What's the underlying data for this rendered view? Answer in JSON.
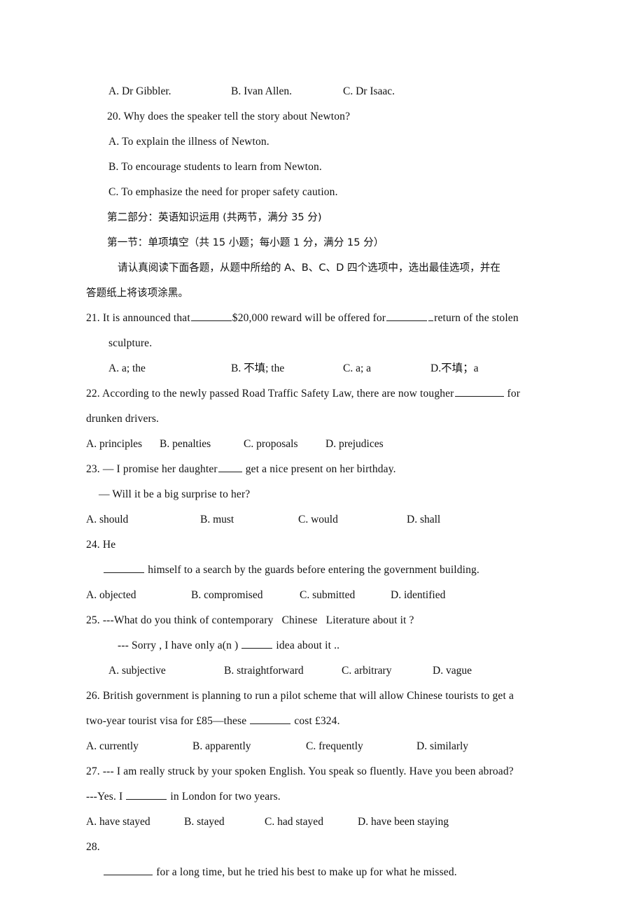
{
  "document": {
    "type": "exam-paper",
    "language_mix": "english-chinese",
    "listening_tail": {
      "q19_options": [
        {
          "label": "A. Dr Gibbler."
        },
        {
          "label": "B. Ivan Allen."
        },
        {
          "label": "C. Dr Isaac."
        }
      ],
      "q20": {
        "stem": "20. Why does the speaker tell the story about Newton?",
        "options": [
          "A. To explain the illness of Newton.",
          "B. To encourage students to learn from Newton.",
          "C. To emphasize the need for proper safety caution."
        ]
      }
    },
    "part_two": {
      "heading": "第二部分：英语知识运用 (共两节，满分 35 分)",
      "section_one_heading": "第一节：单项填空（共 15 小题；每小题 1 分，满分 15 分）",
      "instructions_line1": "请认真阅读下面各题，从题中所给的 A、B、C、D 四个选项中，选出最佳选项，并在",
      "instructions_line2": "答题纸上将该项涂黑。"
    },
    "questions": [
      {
        "number": "21.",
        "stem_part1": "21. It is announced that",
        "stem_part2": "$20,000 reward will be offered for",
        "stem_part3": "return of the stolen",
        "stem_continuation": "sculpture.",
        "options": [
          "A. a; the",
          "B. 不填; the",
          "C. a; a",
          "D.不填；a"
        ]
      },
      {
        "number": "22.",
        "stem_part1": "22. According to the newly passed Road Traffic Safety Law, there are now tougher",
        "stem_part2": "for",
        "stem_continuation": "drunken drivers.",
        "options": [
          "A. principles",
          "B. penalties",
          "C. proposals",
          "D. prejudices"
        ]
      },
      {
        "number": "23.",
        "stem_part1": "23. — I promise her daughter",
        "stem_part2": "get a nice present on her birthday.",
        "stem_continuation": "— Will it be a big surprise to her?",
        "options": [
          "A. should",
          "B.  must",
          "C. would",
          "D. shall"
        ]
      },
      {
        "number": "24.",
        "stem_part1": "24. He",
        "stem_part2": "himself to a search by the guards before entering the government building.",
        "options": [
          "A. objected",
          "B. compromised",
          "C. submitted",
          "D. identified"
        ]
      },
      {
        "number": "25.",
        "stem_part1": "25. ---What do you think of contemporary   Chinese   Literature about it ?",
        "stem_part2a": "--- Sorry , I have only a(n )",
        "stem_part2b": "idea about it ..",
        "options": [
          "A. subjective",
          "B. straightforward",
          "C. arbitrary",
          "D. vague"
        ]
      },
      {
        "number": "26.",
        "stem_part1": "26. British government is planning to run a pilot scheme that will allow Chinese tourists to get a",
        "stem_part2a": "two-year tourist visa for £85—these",
        "stem_part2b": "cost £324.",
        "options": [
          "A. currently",
          "B. apparently",
          "C. frequently",
          "D. similarly"
        ]
      },
      {
        "number": "27.",
        "stem_part1": "27. --- I am really struck by your spoken English. You speak so fluently. Have you been abroad?",
        "stem_part2a": "---Yes. I",
        "stem_part2b": "in London for two years.",
        "options": [
          "A. have stayed",
          "B. stayed",
          "C. had stayed",
          "D. have been staying"
        ]
      },
      {
        "number": "28.",
        "stem_part1": "28.",
        "stem_part2": "for a long time, but he tried his best to make up for what he missed."
      }
    ]
  }
}
